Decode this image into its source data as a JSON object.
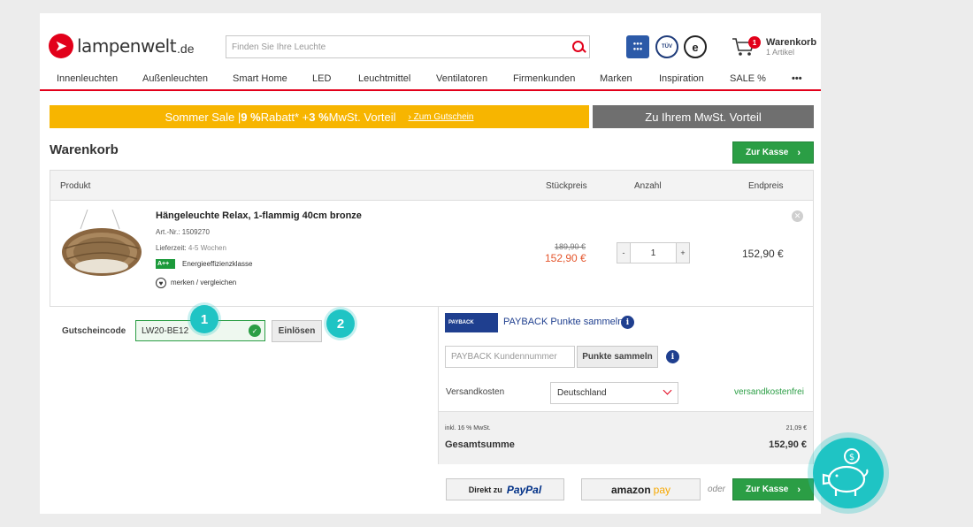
{
  "header": {
    "logo_text": "lampenwelt",
    "logo_tld": ".de",
    "search_placeholder": "Finden Sie Ihre Leuchte",
    "cart_title": "Warenkorb",
    "cart_subtitle": "1 Artikel",
    "cart_count": "1"
  },
  "nav": [
    "Innenleuchten",
    "Außenleuchten",
    "Smart Home",
    "LED",
    "Leuchtmittel",
    "Ventilatoren",
    "Firmenkunden",
    "Marken",
    "Inspiration",
    "SALE %",
    "•••"
  ],
  "promo": {
    "text_a": "Sommer Sale | ",
    "text_b": "9 %",
    "text_c": " Rabatt* + ",
    "text_d": "3 %",
    "text_e": " MwSt. Vorteil",
    "link": "› Zum Gutschein",
    "grey": "Zu Ihrem MwSt. Vorteil"
  },
  "page_title": "Warenkorb",
  "checkout_label": "Zur Kasse",
  "table": {
    "col_product": "Produkt",
    "col_unit_price": "Stückpreis",
    "col_qty": "Anzahl",
    "col_total": "Endpreis"
  },
  "product": {
    "name": "Hängeleuchte Relax, 1-flammig 40cm bronze",
    "art_nr": "Art.-Nr.: 1509270",
    "delivery_label": "Lieferzeit:",
    "delivery_value": "4-5 Wochen",
    "energy_class": "A++",
    "energy_label": "Energieeffizienzklasse",
    "wishlist": "merken / vergleichen",
    "old_price": "189,90 €",
    "price": "152,90 €",
    "quantity": "1",
    "total": "152,90 €"
  },
  "voucher": {
    "label": "Gutscheincode",
    "value": "LW20-BE12",
    "button": "Einlösen",
    "step1": "1",
    "step2": "2"
  },
  "payback": {
    "logo": "PAYBACK",
    "link": "PAYBACK Punkte sammeln",
    "placeholder": "PAYBACK Kundennummer",
    "button": "Punkte sammeln"
  },
  "shipping": {
    "label": "Versandkosten",
    "country": "Deutschland",
    "status": "versandkostenfrei"
  },
  "summary": {
    "vat_label": "inkl. 16 % MwSt.",
    "vat_value": "21,09 €",
    "total_label": "Gesamtsumme",
    "total_value": "152,90 €"
  },
  "payment": {
    "paypal_prefix": "Direkt zu",
    "paypal": "PayPal",
    "amazon": "amazon",
    "amazon_pay": "pay",
    "or": "oder"
  },
  "colors": {
    "brand_red": "#e2001a",
    "green": "#2b9e45",
    "promo_yellow": "#f7b500",
    "teal": "#1fc4c4"
  }
}
